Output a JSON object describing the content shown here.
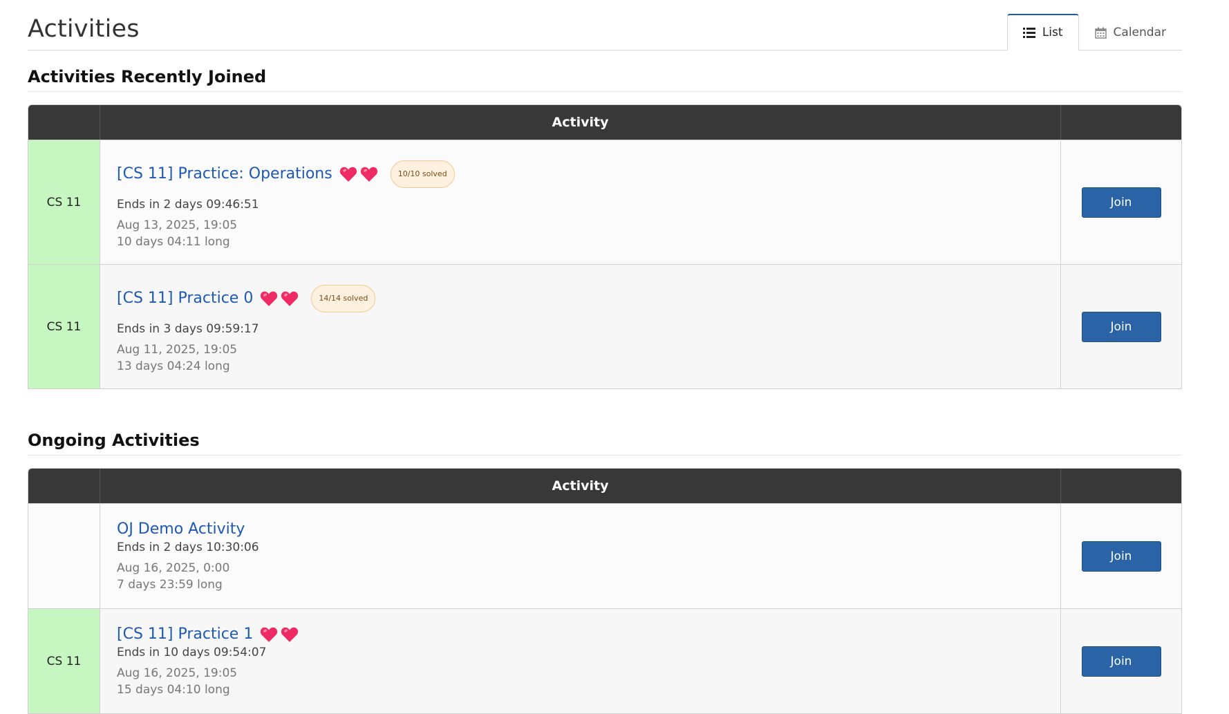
{
  "page": {
    "title": "Activities",
    "view_tabs": [
      {
        "label": "List",
        "icon": "list-icon",
        "active": true
      },
      {
        "label": "Calendar",
        "icon": "calendar-icon",
        "active": false
      }
    ]
  },
  "recent": {
    "title": "Activities Recently Joined",
    "header": {
      "activity": "Activity"
    },
    "rows": [
      {
        "course": "CS 11",
        "title": "[CS 11] Practice: Operations",
        "hearts": 2,
        "solved": "10/10 solved",
        "ends": "Ends in 2 days 09:46:51",
        "date": "Aug 13, 2025, 19:05",
        "length": "10 days 04:11 long",
        "button": "Join"
      },
      {
        "course": "CS 11",
        "title": "[CS 11] Practice 0",
        "hearts": 2,
        "solved": "14/14 solved",
        "ends": "Ends in 3 days 09:59:17",
        "date": "Aug 11, 2025, 19:05",
        "length": "13 days 04:24 long",
        "button": "Join"
      }
    ]
  },
  "ongoing": {
    "title": "Ongoing Activities",
    "header": {
      "activity": "Activity"
    },
    "rows": [
      {
        "course": "",
        "title": "OJ Demo Activity",
        "ends": "Ends in 2 days 10:30:06",
        "date": "Aug 16, 2025, 0:00",
        "length": "7 days 23:59 long",
        "button": "Join"
      },
      {
        "course": "CS 11",
        "title": "[CS 11] Practice 1",
        "hearts": 2,
        "ends": "Ends in 10 days 09:54:07",
        "date": "Aug 16, 2025, 19:05",
        "length": "15 days 04:10 long",
        "button": "Join"
      }
    ]
  },
  "colors": {
    "course_cell": "#c6f7c0",
    "link": "#1d59b3",
    "join_button": "#2a64a7",
    "table_header": "#383838"
  }
}
